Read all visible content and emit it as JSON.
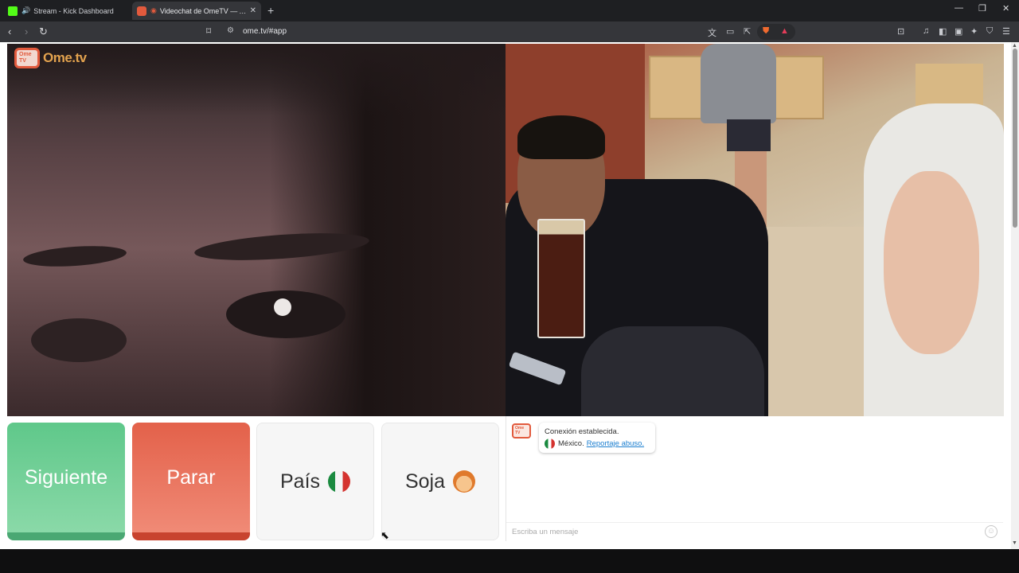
{
  "browser": {
    "tabs": [
      {
        "title": "Stream - Kick Dashboard",
        "favicon": "kick-logo",
        "audio": true,
        "active": false
      },
      {
        "title": "Videochat de OmeTV — Alte",
        "favicon": "ometv-logo",
        "recording": true,
        "active": true
      }
    ],
    "new_tab_label": "+",
    "window_controls": {
      "minimize": "—",
      "restore": "❐",
      "close": "✕"
    },
    "address": "ome.tv/#app",
    "nav": {
      "back": "‹",
      "forward": "›",
      "reload": "↻"
    }
  },
  "site": {
    "logo_text": "Ome.tv",
    "logo_badge": "Ome TV"
  },
  "controls": {
    "next_label": "Siguiente",
    "stop_label": "Parar",
    "country_label": "País",
    "gender_label": "Soja"
  },
  "chat": {
    "system_line1": "Conexión establecida.",
    "system_country": "México.",
    "report_link": "Reportaje abuso.",
    "input_placeholder": "Escriba un mensaje"
  },
  "colors": {
    "next": "#5fc88a",
    "stop": "#e3614a",
    "brand": "#e25a3d",
    "link": "#1c7fd0"
  }
}
